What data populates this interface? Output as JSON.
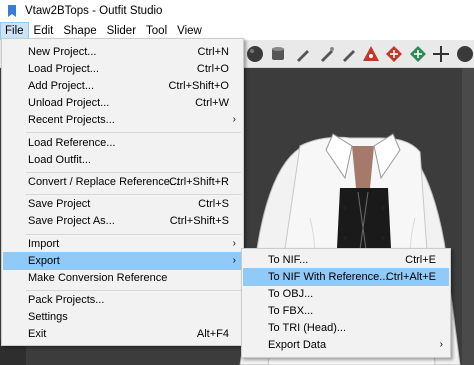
{
  "window": {
    "title": "Vtaw2BTops - Outfit Studio"
  },
  "menubar": {
    "items": [
      "File",
      "Edit",
      "Shape",
      "Slider",
      "Tool",
      "View"
    ]
  },
  "file_menu": {
    "items": [
      {
        "label": "New Project...",
        "shortcut": "Ctrl+N"
      },
      {
        "label": "Load Project...",
        "shortcut": "Ctrl+O"
      },
      {
        "label": "Add Project...",
        "shortcut": "Ctrl+Shift+O"
      },
      {
        "label": "Unload Project...",
        "shortcut": "Ctrl+W"
      },
      {
        "label": "Recent Projects...",
        "shortcut": ""
      },
      {
        "label": "Load Reference...",
        "shortcut": ""
      },
      {
        "label": "Load Outfit...",
        "shortcut": ""
      },
      {
        "label": "Convert / Replace Reference...",
        "shortcut": "Ctrl+Shift+R"
      },
      {
        "label": "Save Project",
        "shortcut": "Ctrl+S"
      },
      {
        "label": "Save Project As...",
        "shortcut": "Ctrl+Shift+S"
      },
      {
        "label": "Import",
        "shortcut": ""
      },
      {
        "label": "Export",
        "shortcut": ""
      },
      {
        "label": "Make Conversion Reference",
        "shortcut": ""
      },
      {
        "label": "Pack Projects...",
        "shortcut": ""
      },
      {
        "label": "Settings",
        "shortcut": ""
      },
      {
        "label": "Exit",
        "shortcut": "Alt+F4"
      }
    ]
  },
  "export_menu": {
    "items": [
      {
        "label": "To NIF...",
        "shortcut": "Ctrl+E"
      },
      {
        "label": "To NIF With Reference...",
        "shortcut": "Ctrl+Alt+E"
      },
      {
        "label": "To OBJ...",
        "shortcut": ""
      },
      {
        "label": "To FBX...",
        "shortcut": ""
      },
      {
        "label": "To TRI (Head)...",
        "shortcut": ""
      },
      {
        "label": "Export Data",
        "shortcut": ""
      }
    ]
  },
  "toolbar_icons": [
    "sphere-icon",
    "cylinder-icon",
    "brush-icon",
    "brush-icon",
    "brush-icon",
    "brush-icon",
    "red-brush-icon",
    "red-brush-icon",
    "move-icon",
    "bone-icon"
  ]
}
